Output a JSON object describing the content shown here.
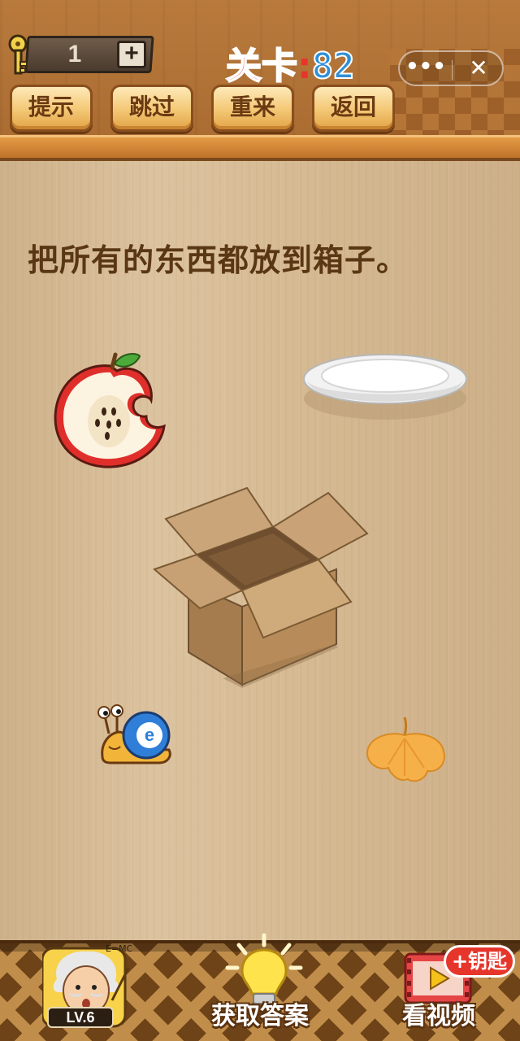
{
  "header": {
    "key_count": "1",
    "key_add_symbol": "+",
    "level_text": "关卡",
    "level_colon": ":",
    "level_number": "82",
    "menu_more": "•••",
    "menu_close": "✕"
  },
  "toolbar": {
    "hint_label": "提示",
    "skip_label": "跳过",
    "retry_label": "重来",
    "back_label": "返回"
  },
  "puzzle": {
    "question": "把所有的东西都放到箱子。",
    "items": [
      "apple",
      "plate",
      "box",
      "snail",
      "leaf"
    ]
  },
  "footer": {
    "level_badge": "LV.6",
    "formula": "E=MC²",
    "get_answer_label": "获取答案",
    "watch_video_label": "看视频",
    "key_reward_badge": "+钥匙"
  },
  "colors": {
    "level_text": "#e8352b",
    "level_number": "#2f8fd8",
    "button_text": "#6b3a12",
    "question_text": "#5a3714",
    "reward_badge": "#e6362c"
  }
}
